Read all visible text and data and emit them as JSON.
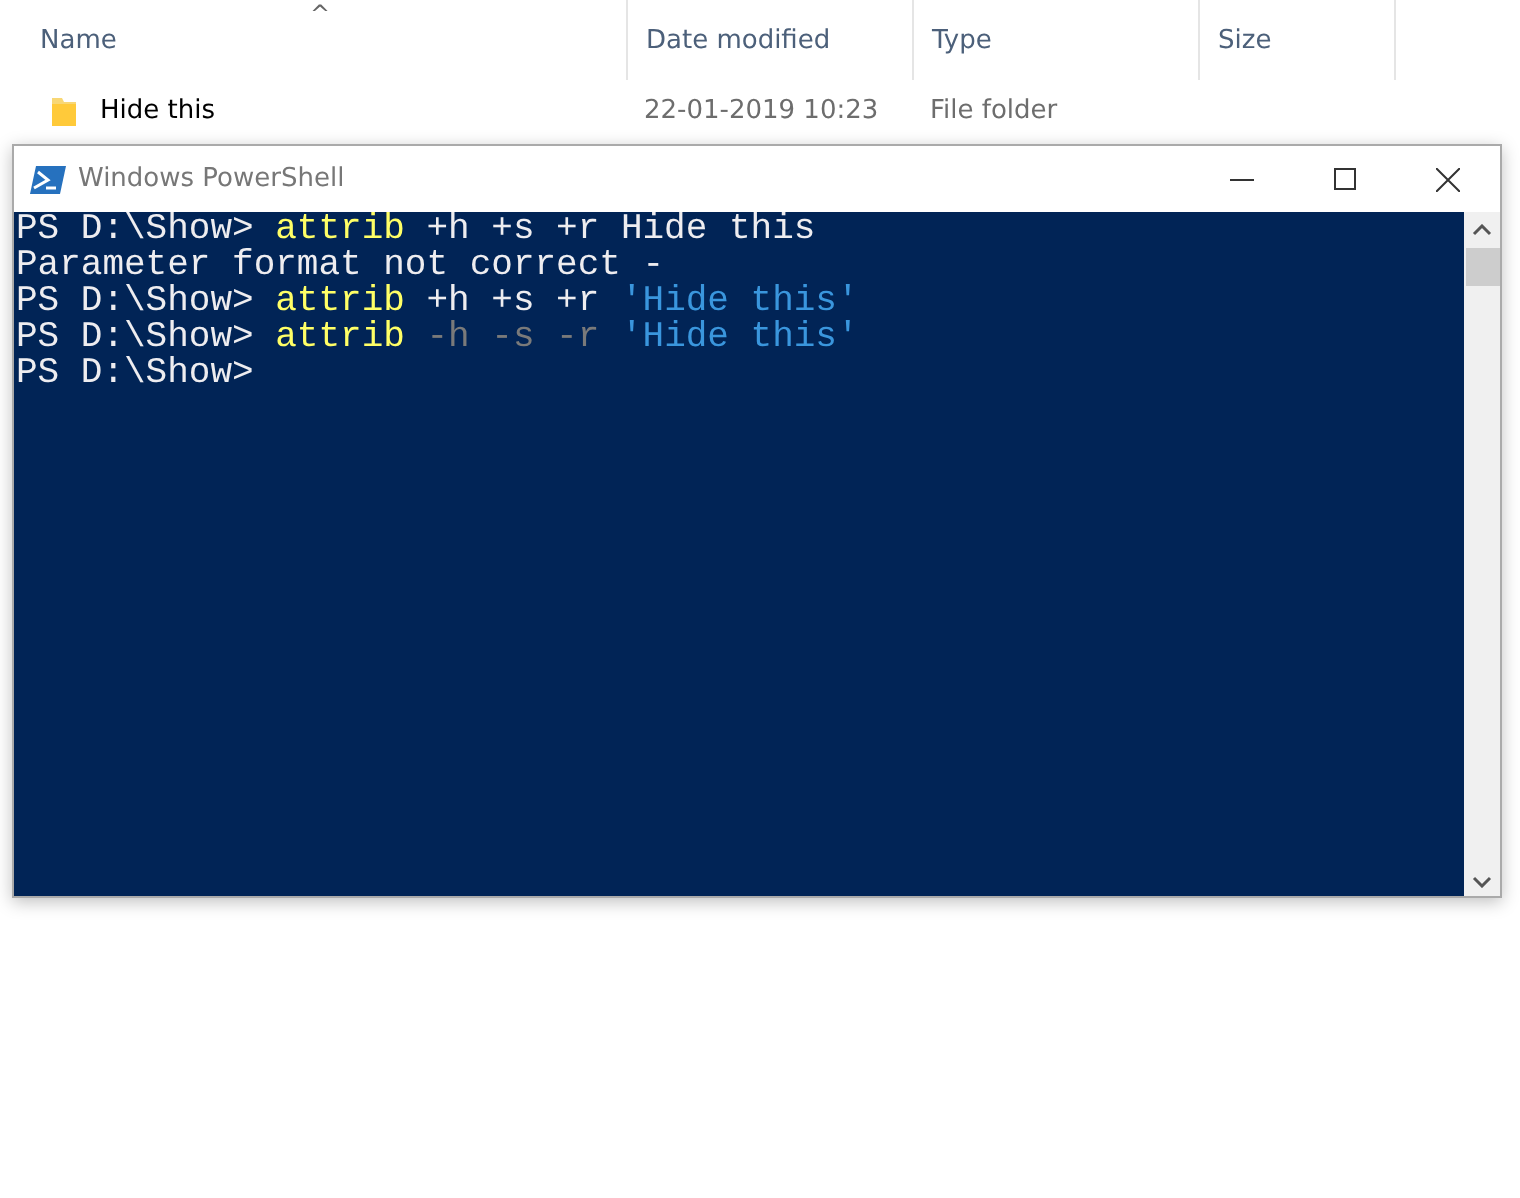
{
  "explorer": {
    "columns": [
      {
        "label": "Name",
        "sorted": true
      },
      {
        "label": "Date modified",
        "sorted": false
      },
      {
        "label": "Type",
        "sorted": false
      },
      {
        "label": "Size",
        "sorted": false
      }
    ],
    "sort_arrow": "^",
    "rows": [
      {
        "name": "Hide this",
        "date": "22-01-2019 10:23",
        "type": "File folder"
      }
    ]
  },
  "console": {
    "window": {
      "title": "Windows PowerShell"
    },
    "lines": [
      [
        {
          "kind": "plain",
          "text": "PS D:\\Show> "
        },
        {
          "kind": "command",
          "text": "attrib"
        },
        {
          "kind": "plain",
          "text": " +h +s +r Hide this"
        }
      ],
      [
        {
          "kind": "plain",
          "text": "Parameter format not correct -"
        }
      ],
      [
        {
          "kind": "plain",
          "text": "PS D:\\Show> "
        },
        {
          "kind": "command",
          "text": "attrib"
        },
        {
          "kind": "plain",
          "text": " +h +s +r "
        },
        {
          "kind": "string",
          "text": "'Hide this'"
        }
      ],
      [
        {
          "kind": "plain",
          "text": "PS D:\\Show> "
        },
        {
          "kind": "command",
          "text": "attrib"
        },
        {
          "kind": "switch",
          "text": " -h -s -r "
        },
        {
          "kind": "string",
          "text": "'Hide this'"
        }
      ],
      [
        {
          "kind": "plain",
          "text": "PS D:\\Show>"
        }
      ]
    ]
  }
}
